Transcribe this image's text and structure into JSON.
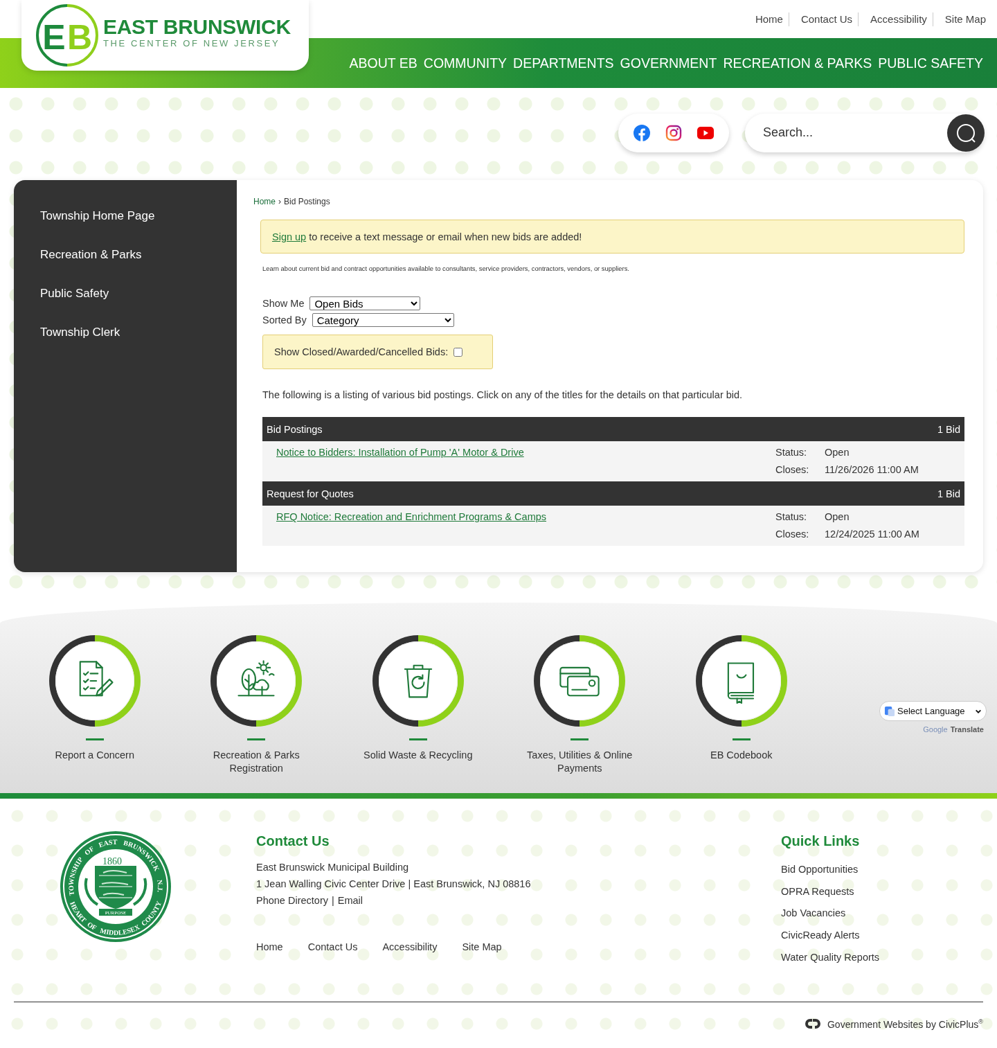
{
  "header": {
    "logo": {
      "monogram": [
        "E",
        "B"
      ],
      "title": "EAST BRUNSWICK",
      "tagline": "THE CENTER OF NEW JERSEY"
    },
    "utility_links": [
      "Home",
      "Contact Us",
      "Accessibility",
      "Site Map"
    ],
    "nav": [
      "ABOUT EB",
      "COMMUNITY",
      "DEPARTMENTS",
      "GOVERNMENT",
      "RECREATION & PARKS",
      "PUBLIC SAFETY"
    ]
  },
  "search": {
    "placeholder": "Search..."
  },
  "sidebar": {
    "items": [
      "Township Home Page",
      "Recreation & Parks",
      "Public Safety",
      "Township Clerk"
    ]
  },
  "breadcrumb": {
    "separator": "›",
    "items": [
      {
        "label": "Home",
        "kind": "link"
      },
      {
        "label": "Bid Postings",
        "kind": "current"
      }
    ]
  },
  "alert": {
    "link": "Sign up",
    "text": "to receive a text message or email when new bids are added!"
  },
  "intro": "Learn about current bid and contract opportunities available to consultants, service providers, contractors, vendors, or suppliers.",
  "filters": [
    {
      "label": "Show Me",
      "value": "Open Bids"
    },
    {
      "label": "Sorted By",
      "value": "Category"
    }
  ],
  "closed_toggle": {
    "label": "Show Closed/Awarded/Cancelled Bids:",
    "checked": false
  },
  "listing_note": "The following is a listing of various bid postings. Click on any of the titles for the details on that particular bid.",
  "categories": [
    {
      "title": "Bid Postings",
      "count": "1 Bid",
      "bids": [
        {
          "title": "Notice to Bidders: Installation of Pump 'A' Motor & Drive",
          "status_label": "Status:",
          "status": "Open",
          "closes_label": "Closes:",
          "closes": "11/26/2026 11:00 AM"
        }
      ]
    },
    {
      "title": "Request for Quotes",
      "count": "1 Bid",
      "bids": [
        {
          "title": "RFQ Notice: Recreation and Enrichment Programs & Camps",
          "status_label": "Status:",
          "status": "Open",
          "closes_label": "Closes:",
          "closes": "12/24/2025 11:00 AM"
        }
      ]
    }
  ],
  "quick_tiles": [
    {
      "label": "Report a Concern",
      "kind": "checklist"
    },
    {
      "label": "Recreation & Parks Registration",
      "kind": "trees"
    },
    {
      "label": "Solid Waste & Recycling",
      "kind": "bin"
    },
    {
      "label": "Taxes, Utilities & Online Payments",
      "kind": "cards"
    },
    {
      "label": "EB Codebook",
      "kind": "book"
    }
  ],
  "language": {
    "value": "Select Language",
    "brand": "Google",
    "product": "Translate"
  },
  "footer": {
    "seal": {
      "ring_top": "TOWNSHIP OF EAST BRUNSWICK N.J.",
      "ring_bottom": "HEART OF MIDDLESEX COUNTY",
      "year": "1860",
      "motto": "PURPOSE"
    },
    "contact": {
      "title": "Contact Us",
      "lines": [
        "East Brunswick Municipal Building",
        "1 Jean Walling Civic Center Drive | East Brunswick, NJ 08816"
      ],
      "links": [
        "Phone Directory",
        "Email"
      ],
      "separator": "|"
    },
    "links": [
      "Home",
      "Contact Us",
      "Accessibility",
      "Site Map"
    ],
    "quick_links": {
      "title": "Quick Links",
      "items": [
        "Bid Opportunities",
        "OPRA Requests",
        "Job Vacancies",
        "CivicReady Alerts",
        "Water Quality Reports"
      ]
    },
    "credit": "Government Websites by CivicPlus$^{®}$"
  }
}
